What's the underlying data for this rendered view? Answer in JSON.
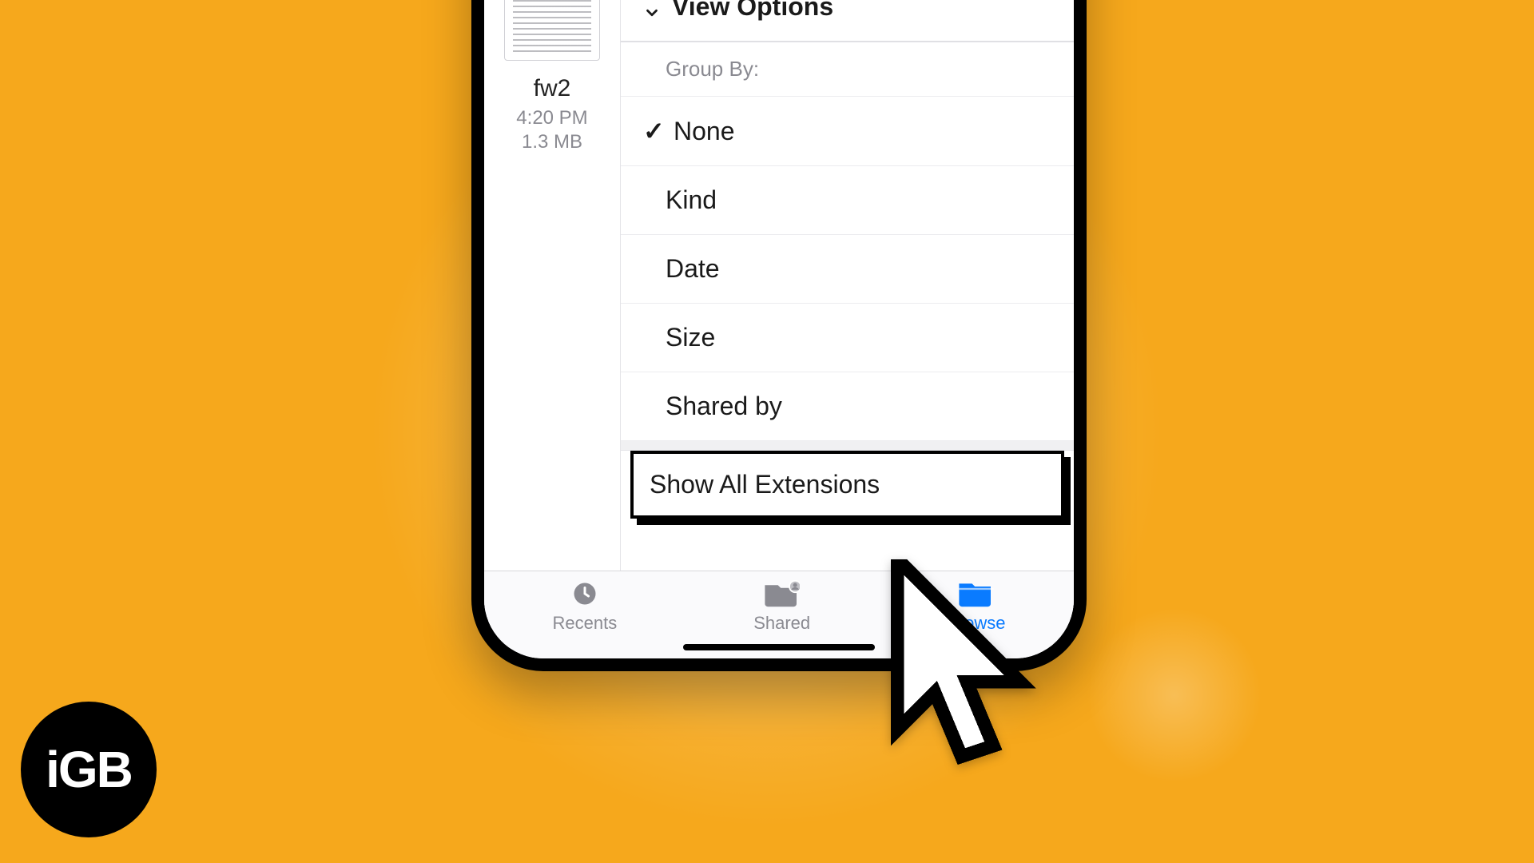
{
  "file": {
    "name": "fw2",
    "time": "4:20 PM",
    "size": "1.3 MB"
  },
  "menu": {
    "header": "View Options",
    "groupby_label": "Group By:",
    "items": {
      "none": "None",
      "kind": "Kind",
      "date": "Date",
      "size": "Size",
      "shared_by": "Shared by"
    },
    "selected": "none",
    "show_all_extensions": "Show All Extensions"
  },
  "tabs": {
    "recents": "Recents",
    "shared": "Shared",
    "browse": "Browse"
  },
  "logo": "iGB",
  "colors": {
    "background": "#f6a81c",
    "accent": "#0a7bff"
  }
}
